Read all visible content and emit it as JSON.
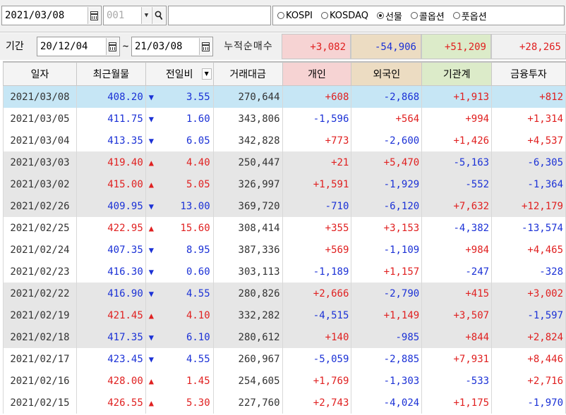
{
  "toolbar": {
    "date": "2021/03/08",
    "code": "001",
    "name": "",
    "markets": [
      {
        "label": "KOSPI",
        "selected": false
      },
      {
        "label": "KOSDAQ",
        "selected": false
      },
      {
        "label": "선물",
        "selected": true
      },
      {
        "label": "콜옵션",
        "selected": false
      },
      {
        "label": "풋옵션",
        "selected": false
      }
    ]
  },
  "period": {
    "label": "기간",
    "from": "20/12/04",
    "tilde": "~",
    "to": "21/03/08",
    "net_label": "누적순매수",
    "sums": [
      "+3,082",
      "-54,906",
      "+51,209",
      "+28,265"
    ]
  },
  "columns": [
    "일자",
    "최근월물",
    "전일비",
    "거래대금",
    "개인",
    "외국인",
    "기관계",
    "금융투자"
  ],
  "rows": [
    {
      "date": "2021/03/08",
      "price": "408.20",
      "dir": "down",
      "chg": "3.55",
      "amount": "270,644",
      "ind": "+608",
      "frn": "-2,868",
      "inst": "+1,913",
      "fin": "+812",
      "bg": "sel"
    },
    {
      "date": "2021/03/05",
      "price": "411.75",
      "dir": "down",
      "chg": "1.60",
      "amount": "343,806",
      "ind": "-1,596",
      "frn": "+564",
      "inst": "+994",
      "fin": "+1,314",
      "bg": ""
    },
    {
      "date": "2021/03/04",
      "price": "413.35",
      "dir": "down",
      "chg": "6.05",
      "amount": "342,828",
      "ind": "+773",
      "frn": "-2,600",
      "inst": "+1,426",
      "fin": "+4,537",
      "bg": ""
    },
    {
      "date": "2021/03/03",
      "price": "419.40",
      "dir": "up",
      "chg": "4.40",
      "amount": "250,447",
      "ind": "+21",
      "frn": "+5,470",
      "inst": "-5,163",
      "fin": "-6,305",
      "bg": "gray"
    },
    {
      "date": "2021/03/02",
      "price": "415.00",
      "dir": "up",
      "chg": "5.05",
      "amount": "326,997",
      "ind": "+1,591",
      "frn": "-1,929",
      "inst": "-552",
      "fin": "-1,364",
      "bg": "gray"
    },
    {
      "date": "2021/02/26",
      "price": "409.95",
      "dir": "down",
      "chg": "13.00",
      "amount": "369,720",
      "ind": "-710",
      "frn": "-6,120",
      "inst": "+7,632",
      "fin": "+12,179",
      "bg": "gray"
    },
    {
      "date": "2021/02/25",
      "price": "422.95",
      "dir": "up",
      "chg": "15.60",
      "amount": "308,414",
      "ind": "+355",
      "frn": "+3,153",
      "inst": "-4,382",
      "fin": "-13,574",
      "bg": ""
    },
    {
      "date": "2021/02/24",
      "price": "407.35",
      "dir": "down",
      "chg": "8.95",
      "amount": "387,336",
      "ind": "+569",
      "frn": "-1,109",
      "inst": "+984",
      "fin": "+4,465",
      "bg": ""
    },
    {
      "date": "2021/02/23",
      "price": "416.30",
      "dir": "down",
      "chg": "0.60",
      "amount": "303,113",
      "ind": "-1,189",
      "frn": "+1,157",
      "inst": "-247",
      "fin": "-328",
      "bg": ""
    },
    {
      "date": "2021/02/22",
      "price": "416.90",
      "dir": "down",
      "chg": "4.55",
      "amount": "280,826",
      "ind": "+2,666",
      "frn": "-2,790",
      "inst": "+415",
      "fin": "+3,002",
      "bg": "gray"
    },
    {
      "date": "2021/02/19",
      "price": "421.45",
      "dir": "up",
      "chg": "4.10",
      "amount": "332,282",
      "ind": "-4,515",
      "frn": "+1,149",
      "inst": "+3,507",
      "fin": "-1,597",
      "bg": "gray"
    },
    {
      "date": "2021/02/18",
      "price": "417.35",
      "dir": "down",
      "chg": "6.10",
      "amount": "280,612",
      "ind": "+140",
      "frn": "-985",
      "inst": "+844",
      "fin": "+2,824",
      "bg": "gray"
    },
    {
      "date": "2021/02/17",
      "price": "423.45",
      "dir": "down",
      "chg": "4.55",
      "amount": "260,967",
      "ind": "-5,059",
      "frn": "-2,885",
      "inst": "+7,931",
      "fin": "+8,446",
      "bg": ""
    },
    {
      "date": "2021/02/16",
      "price": "428.00",
      "dir": "up",
      "chg": "1.45",
      "amount": "254,605",
      "ind": "+1,769",
      "frn": "-1,303",
      "inst": "-533",
      "fin": "+2,716",
      "bg": ""
    },
    {
      "date": "2021/02/15",
      "price": "426.55",
      "dir": "up",
      "chg": "5.30",
      "amount": "227,760",
      "ind": "+2,743",
      "frn": "-4,024",
      "inst": "+1,175",
      "fin": "-1,970",
      "bg": ""
    }
  ],
  "colors": {
    "up": "#e02020",
    "down": "#1b31d6",
    "selected_row": "#c6e6f5",
    "gray_row": "#e6e6e6",
    "individual_header": "#f6d3d3",
    "foreign_header": "#ecdcc2",
    "institution_header": "#dcebc9",
    "finance_header": "#f1f1f1"
  }
}
